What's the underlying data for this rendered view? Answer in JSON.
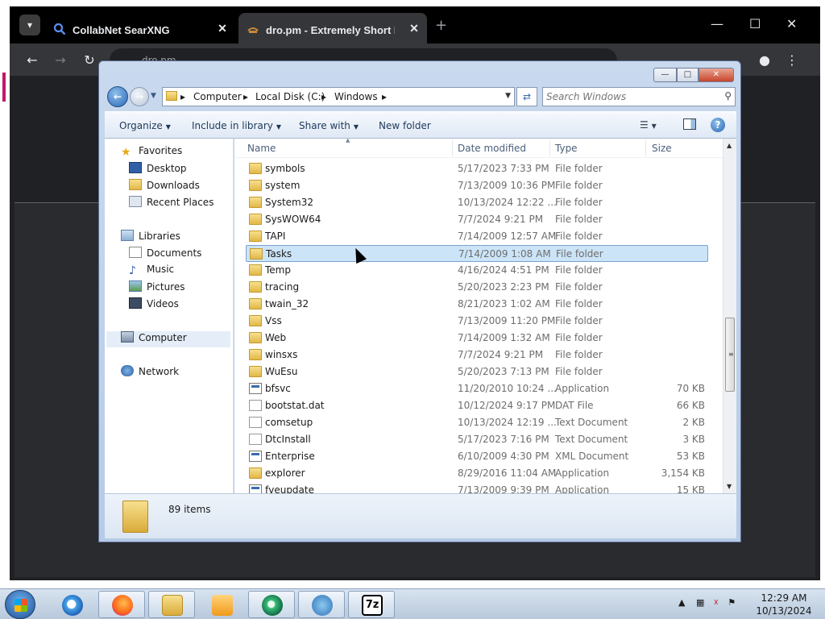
{
  "browser": {
    "tabs": [
      {
        "label": "CollabNet SearXNG",
        "active": false
      },
      {
        "label": "dro.pm - Extremely Short Link",
        "active": true
      }
    ],
    "omnibox_text": "dro.pm",
    "accent": "#202124"
  },
  "explorer": {
    "breadcrumb": [
      "Computer",
      "Local Disk (C:)",
      "Windows"
    ],
    "search_placeholder": "Search Windows",
    "commands": {
      "organize": "Organize",
      "include_in_library": "Include in library",
      "share_with": "Share with",
      "new_folder": "New folder"
    },
    "columns": {
      "name": "Name",
      "date": "Date modified",
      "type": "Type",
      "size": "Size"
    },
    "nav": {
      "favorites": "Favorites",
      "desktop": "Desktop",
      "downloads": "Downloads",
      "recent": "Recent Places",
      "libraries": "Libraries",
      "documents": "Documents",
      "music": "Music",
      "pictures": "Pictures",
      "videos": "Videos",
      "computer": "Computer",
      "network": "Network"
    },
    "rows": [
      {
        "name": "symbols",
        "date": "5/17/2023 7:33 PM",
        "type": "File folder",
        "size": "",
        "kind": "folder"
      },
      {
        "name": "system",
        "date": "7/13/2009 10:36 PM",
        "type": "File folder",
        "size": "",
        "kind": "folder"
      },
      {
        "name": "System32",
        "date": "10/13/2024 12:22 ...",
        "type": "File folder",
        "size": "",
        "kind": "folder"
      },
      {
        "name": "SysWOW64",
        "date": "7/7/2024 9:21 PM",
        "type": "File folder",
        "size": "",
        "kind": "folder"
      },
      {
        "name": "TAPI",
        "date": "7/14/2009 12:57 AM",
        "type": "File folder",
        "size": "",
        "kind": "folder"
      },
      {
        "name": "Tasks",
        "date": "7/14/2009 1:08 AM",
        "type": "File folder",
        "size": "",
        "kind": "folder",
        "selected": true
      },
      {
        "name": "Temp",
        "date": "4/16/2024 4:51 PM",
        "type": "File folder",
        "size": "",
        "kind": "folder"
      },
      {
        "name": "tracing",
        "date": "5/20/2023 2:23 PM",
        "type": "File folder",
        "size": "",
        "kind": "folder"
      },
      {
        "name": "twain_32",
        "date": "8/21/2023 1:02 AM",
        "type": "File folder",
        "size": "",
        "kind": "folder"
      },
      {
        "name": "Vss",
        "date": "7/13/2009 11:20 PM",
        "type": "File folder",
        "size": "",
        "kind": "folder"
      },
      {
        "name": "Web",
        "date": "7/14/2009 1:32 AM",
        "type": "File folder",
        "size": "",
        "kind": "folder"
      },
      {
        "name": "winsxs",
        "date": "7/7/2024 9:21 PM",
        "type": "File folder",
        "size": "",
        "kind": "folder"
      },
      {
        "name": "WuEsu",
        "date": "5/20/2023 7:13 PM",
        "type": "File folder",
        "size": "",
        "kind": "folder"
      },
      {
        "name": "bfsvc",
        "date": "11/20/2010 10:24 ...",
        "type": "Application",
        "size": "70 KB",
        "kind": "app"
      },
      {
        "name": "bootstat.dat",
        "date": "10/12/2024 9:17 PM",
        "type": "DAT File",
        "size": "66 KB",
        "kind": "doc"
      },
      {
        "name": "comsetup",
        "date": "10/13/2024 12:19 ...",
        "type": "Text Document",
        "size": "2 KB",
        "kind": "doc"
      },
      {
        "name": "DtcInstall",
        "date": "5/17/2023 7:16 PM",
        "type": "Text Document",
        "size": "3 KB",
        "kind": "doc"
      },
      {
        "name": "Enterprise",
        "date": "6/10/2009 4:30 PM",
        "type": "XML Document",
        "size": "53 KB",
        "kind": "app"
      },
      {
        "name": "explorer",
        "date": "8/29/2016 11:04 AM",
        "type": "Application",
        "size": "3,154 KB",
        "kind": "folder"
      },
      {
        "name": "fveupdate",
        "date": "7/13/2009 9:39 PM",
        "type": "Application",
        "size": "15 KB",
        "kind": "app"
      }
    ],
    "status": "89 items"
  },
  "taskbar": {
    "clock_time": "12:29 AM",
    "clock_date": "10/13/2024",
    "apps": [
      "internet-explorer-icon",
      "firefox-icon",
      "explorer-icon",
      "media-player-icon",
      "chrome-like-icon",
      "network-tool-icon",
      "7zip-icon"
    ],
    "seven_zip_label": "7z"
  }
}
